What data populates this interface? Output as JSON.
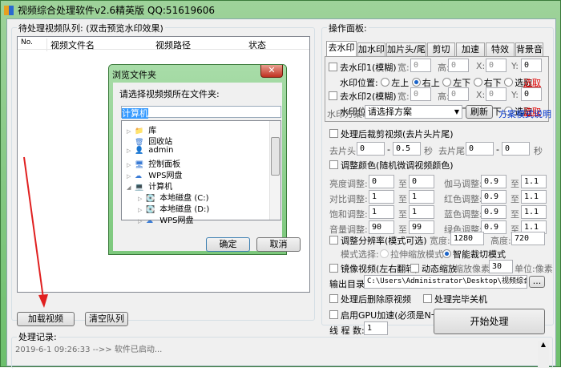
{
  "window": {
    "title": "视频综合处理软件v2.6精英版  QQ:51619606"
  },
  "queue": {
    "legend": "待处理视频队列: (双击预览水印效果)",
    "columns": [
      "No.",
      "视频文件名",
      "视频路径",
      "状态"
    ],
    "load_button": "加载视频",
    "clear_button": "清空队列"
  },
  "log": {
    "legend": "处理记录:",
    "entries": [
      "2019-6-1 09:26:33 -->> 软件已启动..."
    ]
  },
  "panel": {
    "legend": "操作面板:",
    "tabs": [
      "去水印",
      "加水印",
      "加片头/尾",
      "剪切",
      "加速",
      "特效",
      "背景音"
    ],
    "wm1": {
      "label": "去水印1(模糊)",
      "w": "0",
      "h": "0",
      "x": "0",
      "y": "0"
    },
    "wm2": {
      "label": "去水印2(模糊)",
      "w": "0",
      "h": "0",
      "x": "0",
      "y": "0"
    },
    "lbl_w": "宽:",
    "lbl_h": "高:",
    "lbl_x": "X:",
    "lbl_y": "Y:",
    "pos_label": "水印位置:",
    "positions": [
      "左上",
      "右上",
      "左下",
      "右下",
      "选取"
    ],
    "pick_link": "选取",
    "scheme_label": "水印方案:",
    "scheme_value": "请选择方案",
    "refresh": "刷新",
    "scheme_help": "方案模式说明",
    "trim": {
      "label": "处理后裁剪视频(去片头片尾)",
      "head": "去片头:",
      "head_from": "0",
      "head_to": "0.5",
      "tail": "去片尾:",
      "tail_from": "0",
      "tail_to": "0",
      "sec": "秒",
      "dash": "-"
    },
    "color": {
      "label": "调整颜色(随机微调视频颜色)",
      "to": "至",
      "rows": [
        {
          "name": "亮度调整:",
          "a": "0",
          "b": "0",
          "name2": "伽马调整:",
          "c": "0.9",
          "d": "1.1"
        },
        {
          "name": "对比调整:",
          "a": "1",
          "b": "1",
          "name2": "红色调整:",
          "c": "0.9",
          "d": "1.1"
        },
        {
          "name": "饱和调整:",
          "a": "1",
          "b": "1",
          "name2": "蓝色调整:",
          "c": "0.9",
          "d": "1.1"
        },
        {
          "name": "音量调整:",
          "a": "90",
          "b": "99",
          "name2": "绿色调整:",
          "c": "0.9",
          "d": "1.1"
        }
      ]
    },
    "res": {
      "label": "调整分辨率(模式可选)",
      "w_label": "宽度:",
      "w": "1280",
      "h_label": "高度:",
      "h": "720",
      "mode_label": "模式选择:",
      "mode1": "拉伸缩放模式",
      "mode2": "智能裁切模式"
    },
    "mirror": "镜像视频(左右翻转)",
    "zoom": "动态缩放",
    "zoom_px_label": "缩放像素:",
    "zoom_px": "30",
    "unit": "单位:像素",
    "output_label": "输出目录:",
    "output_path": "C:\\Users\\Administrator\\Desktop\\视频综合处理软",
    "browse": "...",
    "delete_src": "处理后删除原视频",
    "shutdown": "处理完毕关机",
    "gpu": "启用GPU加速(必须是N卡)",
    "threads_label": "线 程 数:",
    "threads": "1",
    "start": "开始处理"
  },
  "dialog": {
    "title": "浏览文件夹",
    "prompt": "请选择视频频所在文件夹:",
    "selected": "计算机",
    "tree": [
      "库",
      "回收站",
      "admin",
      "控制面板",
      "WPS网盘",
      "计算机",
      "本地磁盘 (C:)",
      "本地磁盘 (D:)",
      "WPS网盘"
    ],
    "ok": "确定",
    "cancel": "取消"
  },
  "colors": {
    "accent": "#1c64c8",
    "link_red": "#e00000",
    "link_blue": "#0033cc",
    "arrow": "#e02020"
  }
}
